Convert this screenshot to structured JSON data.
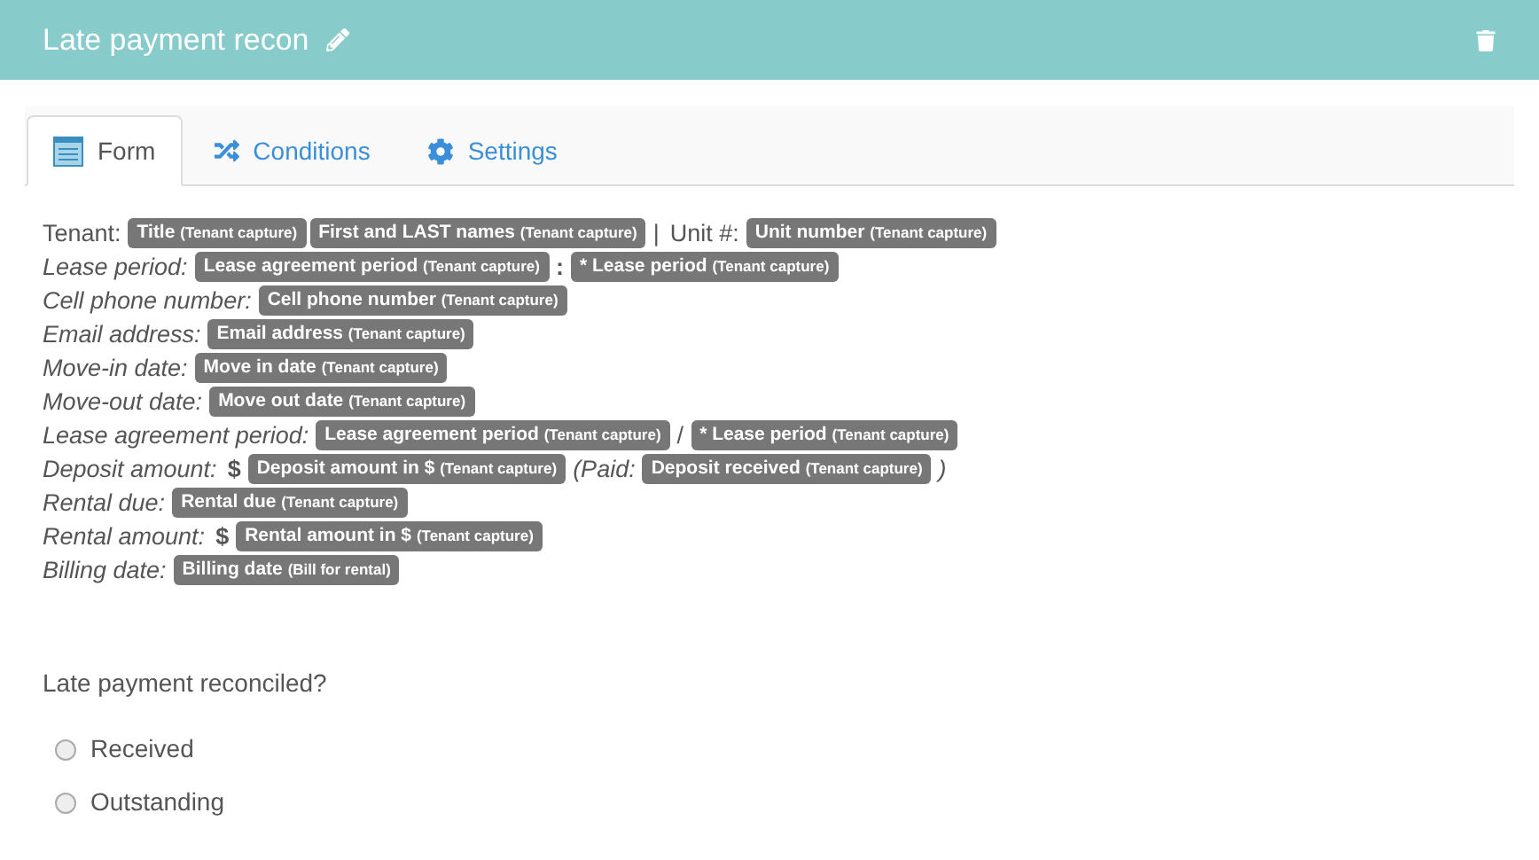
{
  "header": {
    "title": "Late payment recon"
  },
  "tabs": [
    {
      "label": "Form",
      "selected": true
    },
    {
      "label": "Conditions",
      "selected": false
    },
    {
      "label": "Settings",
      "selected": false
    }
  ],
  "lines": [
    {
      "parts": [
        {
          "kind": "text",
          "text": "Tenant:",
          "italic": false
        },
        {
          "kind": "tag",
          "name": "Title",
          "source": "(Tenant capture)"
        },
        {
          "kind": "tag",
          "name": "First and LAST names",
          "source": "(Tenant capture)"
        },
        {
          "kind": "text",
          "text": "|",
          "italic": false
        },
        {
          "kind": "text",
          "text": "Unit #:",
          "italic": false
        },
        {
          "kind": "tag",
          "name": "Unit number",
          "source": "(Tenant capture)"
        }
      ]
    },
    {
      "parts": [
        {
          "kind": "text",
          "text": "Lease period:",
          "italic": true
        },
        {
          "kind": "tag",
          "name": "Lease agreement period",
          "source": "(Tenant capture)"
        },
        {
          "kind": "text",
          "text": ":",
          "italic": false,
          "bold": true
        },
        {
          "kind": "tag",
          "name": "* Lease period",
          "source": "(Tenant capture)"
        }
      ]
    },
    {
      "parts": [
        {
          "kind": "text",
          "text": "Cell phone number:",
          "italic": true
        },
        {
          "kind": "tag",
          "name": "Cell phone number",
          "source": "(Tenant capture)"
        }
      ]
    },
    {
      "parts": [
        {
          "kind": "text",
          "text": "Email address:",
          "italic": true
        },
        {
          "kind": "tag",
          "name": "Email address",
          "source": "(Tenant capture)"
        }
      ]
    },
    {
      "parts": [
        {
          "kind": "text",
          "text": "Move-in date:",
          "italic": true
        },
        {
          "kind": "tag",
          "name": "Move in date",
          "source": "(Tenant capture)"
        }
      ]
    },
    {
      "parts": [
        {
          "kind": "text",
          "text": "Move-out date:",
          "italic": true
        },
        {
          "kind": "tag",
          "name": "Move out date",
          "source": "(Tenant capture)"
        }
      ]
    },
    {
      "parts": [
        {
          "kind": "text",
          "text": "Lease agreement period:",
          "italic": true
        },
        {
          "kind": "tag",
          "name": "Lease agreement period",
          "source": "(Tenant capture)"
        },
        {
          "kind": "text",
          "text": "/",
          "italic": false
        },
        {
          "kind": "tag",
          "name": "* Lease period",
          "source": "(Tenant capture)"
        }
      ]
    },
    {
      "parts": [
        {
          "kind": "text",
          "text": "Deposit amount:",
          "italic": true
        },
        {
          "kind": "text",
          "text": "$",
          "italic": false,
          "bold": true
        },
        {
          "kind": "tag",
          "name": "Deposit amount in $",
          "source": "(Tenant capture)"
        },
        {
          "kind": "text",
          "text": "(Paid:",
          "italic": true
        },
        {
          "kind": "tag",
          "name": "Deposit received",
          "source": "(Tenant capture)"
        },
        {
          "kind": "text",
          "text": ")",
          "italic": true
        }
      ]
    },
    {
      "parts": [
        {
          "kind": "text",
          "text": "Rental due:",
          "italic": true
        },
        {
          "kind": "tag",
          "name": "Rental due",
          "source": "(Tenant capture)"
        }
      ]
    },
    {
      "parts": [
        {
          "kind": "text",
          "text": "Rental amount:",
          "italic": true
        },
        {
          "kind": "text",
          "text": "$",
          "italic": false,
          "bold": true
        },
        {
          "kind": "tag",
          "name": "Rental amount in $",
          "source": "(Tenant capture)"
        }
      ]
    },
    {
      "parts": [
        {
          "kind": "text",
          "text": "Billing date:",
          "italic": true
        },
        {
          "kind": "tag",
          "name": "Billing date",
          "source": "(Bill for rental)"
        }
      ]
    }
  ],
  "question": {
    "label": "Late payment reconciled?",
    "options": [
      {
        "label": "Received",
        "selected": false
      },
      {
        "label": "Outstanding",
        "selected": false
      }
    ]
  }
}
